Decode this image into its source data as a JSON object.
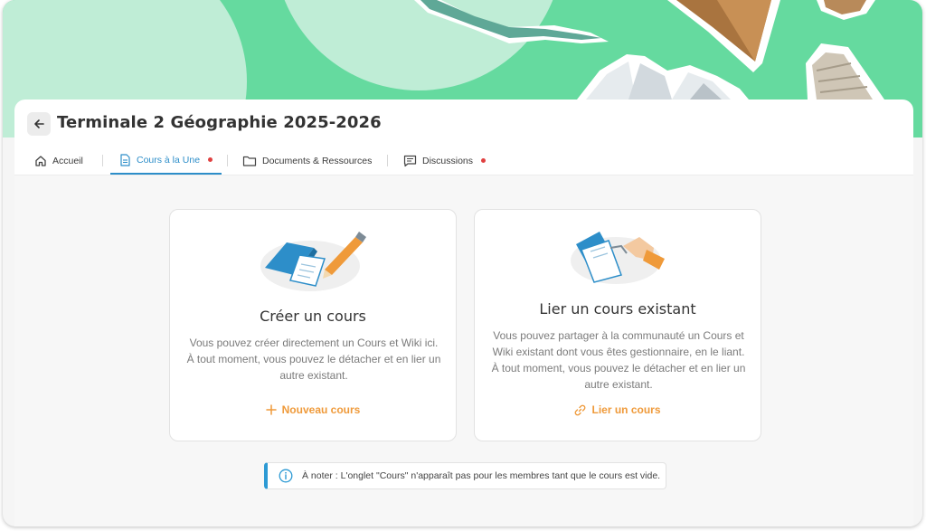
{
  "header": {
    "title": "Terminale 2 Géographie 2025-2026"
  },
  "tabs": [
    {
      "label": "Accueil",
      "icon": "home-icon"
    },
    {
      "label": "Cours à la Une",
      "icon": "document-icon",
      "active": true,
      "notification": true
    },
    {
      "label": "Documents & Ressources",
      "icon": "folder-icon"
    },
    {
      "label": "Discussions",
      "icon": "chat-icon",
      "notification": true
    }
  ],
  "cards": {
    "create": {
      "title": "Créer un cours",
      "description": "Vous pouvez créer directement un Cours et Wiki ici. À tout moment, vous pouvez le détacher et en lier un autre existant.",
      "action": "Nouveau cours",
      "action_icon": "plus-icon"
    },
    "link": {
      "title": "Lier un cours existant",
      "description": "Vous pouvez partager à la communauté un Cours et Wiki existant dont vous êtes gestionnaire, en le liant. À tout moment, vous pouvez le détacher et en lier un autre existant.",
      "action": "Lier un cours",
      "action_icon": "link-icon"
    }
  },
  "note": {
    "text": "À noter : L'onglet \"Cours\" n'apparaît pas pour les membres tant que le cours est vide.",
    "icon": "info-icon"
  },
  "colors": {
    "accent": "#2d8ec9",
    "action": "#ef9a3a",
    "hero": "#65da9f",
    "notification": "#e04040"
  }
}
